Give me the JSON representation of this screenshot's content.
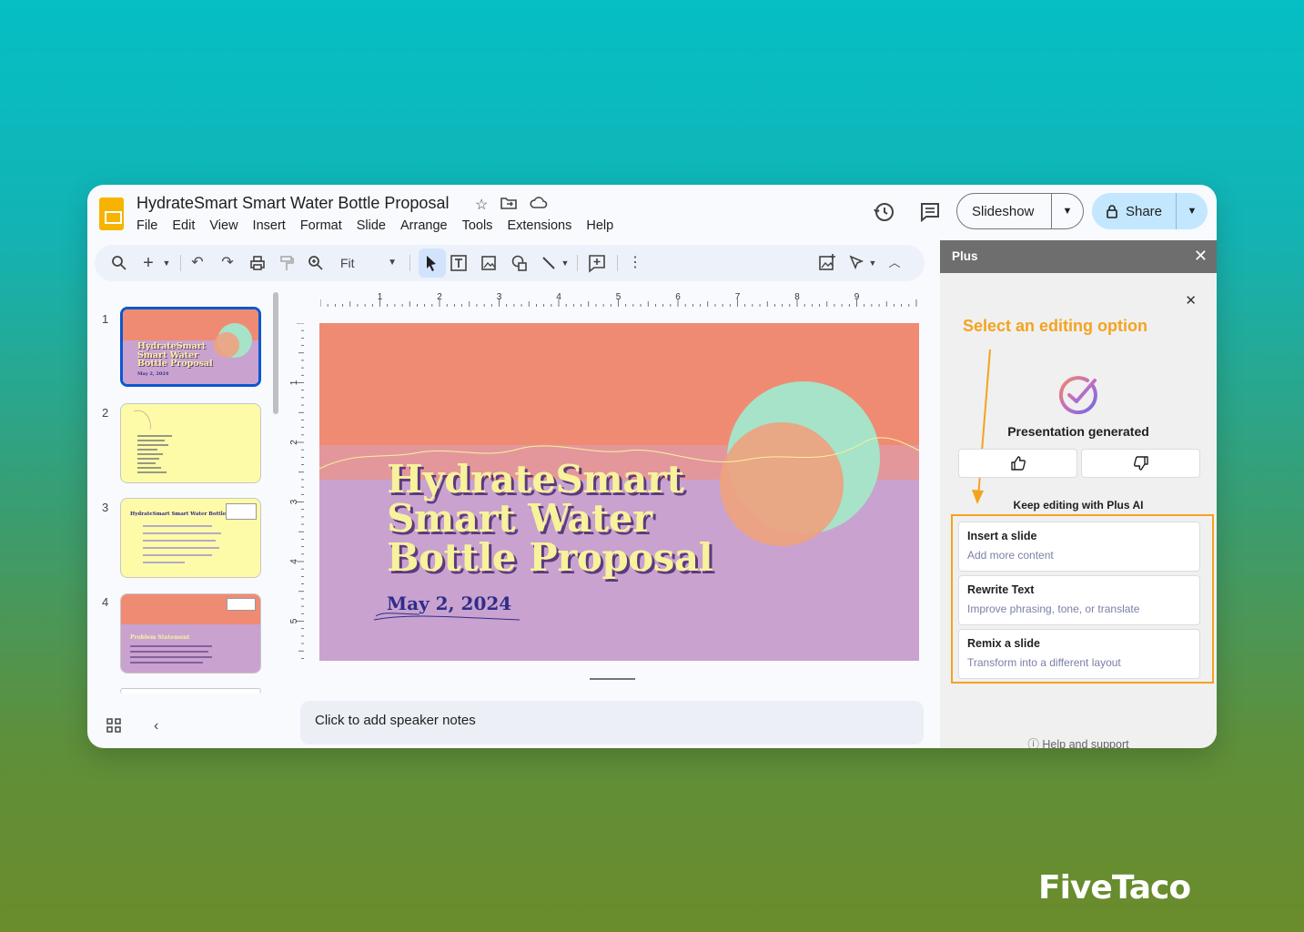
{
  "app": {
    "title": "HydrateSmart Smart Water Bottle Proposal",
    "menu": [
      "File",
      "Edit",
      "View",
      "Insert",
      "Format",
      "Slide",
      "Arrange",
      "Tools",
      "Extensions",
      "Help"
    ],
    "slideshow_label": "Slideshow",
    "share_label": "Share"
  },
  "toolbar": {
    "zoom_value": "Fit"
  },
  "filmstrip": {
    "slide_numbers": [
      "1",
      "2",
      "3",
      "4"
    ],
    "thumb1_title": "HydrateSmart Smart Water Bottle Proposal",
    "thumb1_date": "May 2, 2024",
    "thumb3_title": "HydrateSmart Smart Water Bottle",
    "thumb4_title": "Problem Statement"
  },
  "ruler": {
    "h_labels": [
      "1",
      "2",
      "3",
      "4",
      "5",
      "6",
      "7",
      "8",
      "9"
    ],
    "v_labels": [
      "1",
      "2",
      "3",
      "4",
      "5"
    ]
  },
  "slide": {
    "title_line1": "HydrateSmart",
    "title_line2": "Smart Water",
    "title_line3": "Bottle Proposal",
    "date": "May 2, 2024",
    "colors": {
      "top": "#f08b73",
      "bottom": "#c9a2cf",
      "title": "#f7f29b",
      "circle_green": "#a6e3c8",
      "circle_orange": "#eea27f"
    }
  },
  "notes": {
    "placeholder": "Click to add speaker notes"
  },
  "panel": {
    "title": "Plus",
    "annotation": "Select an editing option",
    "generated_label": "Presentation generated",
    "keep_editing_label": "Keep editing with Plus AI",
    "options": [
      {
        "title": "Insert a slide",
        "subtitle": "Add more content"
      },
      {
        "title": "Rewrite Text",
        "subtitle": "Improve phrasing, tone, or translate"
      },
      {
        "title": "Remix a slide",
        "subtitle": "Transform into a different layout"
      }
    ],
    "help_label": "Help and support",
    "accent": "#f4a31f"
  },
  "brand": {
    "name": "FiveTaco"
  }
}
